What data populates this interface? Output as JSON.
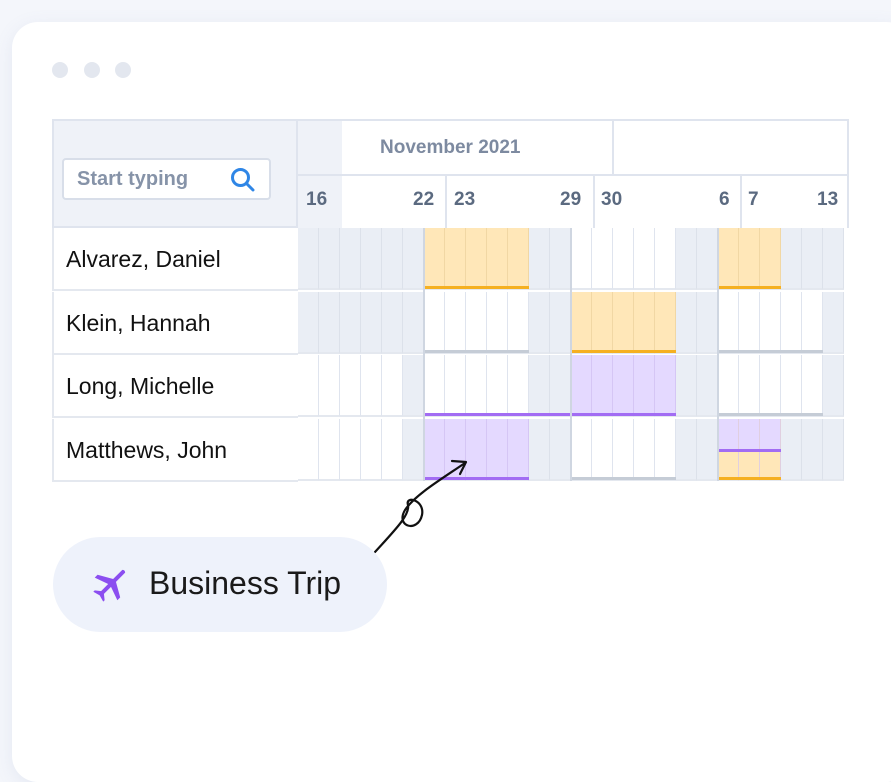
{
  "search": {
    "placeholder": "Start typing",
    "icon": "search-icon"
  },
  "calendar": {
    "month": "November 2021",
    "week_labels": [
      {
        "start": "16",
        "end": "22"
      },
      {
        "start": "23",
        "end": "29"
      },
      {
        "start": "30",
        "end": "6"
      },
      {
        "start": "7",
        "end": "13"
      }
    ]
  },
  "employees": [
    {
      "name": "Alvarez, Daniel"
    },
    {
      "name": "Klein, Hannah"
    },
    {
      "name": "Long, Michelle"
    },
    {
      "name": "Matthews, John"
    }
  ],
  "legend": {
    "label": "Business Trip",
    "icon": "airplane-icon",
    "color": "#8b4ef0"
  },
  "colors": {
    "vacation_fill": "#ffe7b8",
    "vacation_bar": "#f5b021",
    "trip_fill": "#e4d9ff",
    "trip_bar": "#a26cf3",
    "weekend": "#eaeef5",
    "neutral_bar": "#c5ccd6"
  }
}
